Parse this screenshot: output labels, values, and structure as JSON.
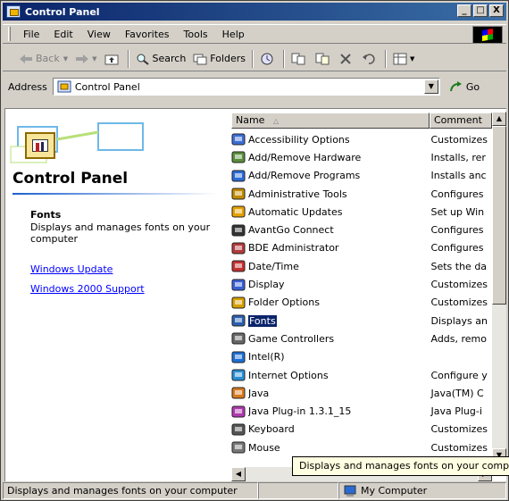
{
  "window": {
    "title": "Control Panel",
    "controls": [
      "_",
      "□",
      "X"
    ]
  },
  "menu": [
    "File",
    "Edit",
    "View",
    "Favorites",
    "Tools",
    "Help"
  ],
  "toolbar": {
    "back": "Back",
    "search": "Search",
    "folders": "Folders"
  },
  "address": {
    "label": "Address",
    "value": "Control Panel",
    "go": "Go"
  },
  "left_pane": {
    "title": "Control Panel",
    "selected_heading": "Fonts",
    "selected_desc": "Displays and manages fonts on your computer",
    "links": [
      "Windows Update",
      "Windows 2000 Support"
    ]
  },
  "columns": {
    "name": "Name",
    "comment": "Comment"
  },
  "items": [
    {
      "name": "Accessibility Options",
      "comment": "Customizes",
      "icon": "accessibility-icon"
    },
    {
      "name": "Add/Remove Hardware",
      "comment": "Installs, rer",
      "icon": "hardware-icon"
    },
    {
      "name": "Add/Remove Programs",
      "comment": "Installs anc",
      "icon": "programs-icon"
    },
    {
      "name": "Administrative Tools",
      "comment": "Configures",
      "icon": "admin-tools-icon"
    },
    {
      "name": "Automatic Updates",
      "comment": "Set up Win",
      "icon": "updates-icon"
    },
    {
      "name": "AvantGo Connect",
      "comment": "Configures",
      "icon": "avantgo-icon"
    },
    {
      "name": "BDE Administrator",
      "comment": "Configures",
      "icon": "bde-icon"
    },
    {
      "name": "Date/Time",
      "comment": "Sets the da",
      "icon": "datetime-icon"
    },
    {
      "name": "Display",
      "comment": "Customizes",
      "icon": "display-icon"
    },
    {
      "name": "Folder Options",
      "comment": "Customizes",
      "icon": "folder-options-icon"
    },
    {
      "name": "Fonts",
      "comment": "Displays an",
      "icon": "fonts-icon"
    },
    {
      "name": "Game Controllers",
      "comment": "Adds, remo",
      "icon": "game-controllers-icon"
    },
    {
      "name": "Intel(R)",
      "comment": "",
      "icon": "intel-icon"
    },
    {
      "name": "Internet Options",
      "comment": "Configure y",
      "icon": "internet-options-icon"
    },
    {
      "name": "Java",
      "comment": "Java(TM) C",
      "icon": "java-icon"
    },
    {
      "name": "Java Plug-in 1.3.1_15",
      "comment": "Java Plug-i",
      "icon": "java-plugin-icon"
    },
    {
      "name": "Keyboard",
      "comment": "Customizes",
      "icon": "keyboard-icon"
    },
    {
      "name": "Mouse",
      "comment": "Customizes",
      "icon": "mouse-icon"
    }
  ],
  "selected_index": 10,
  "tooltip": "Displays and manages fonts on your comp",
  "status": {
    "text": "Displays and manages fonts on your computer",
    "zone": "My Computer"
  },
  "colors": {
    "title_start": "#0a246a",
    "title_end": "#3a6ea5",
    "selection": "#0a246a",
    "link": "#0000ff",
    "tooltip_bg": "#ffffe1"
  }
}
